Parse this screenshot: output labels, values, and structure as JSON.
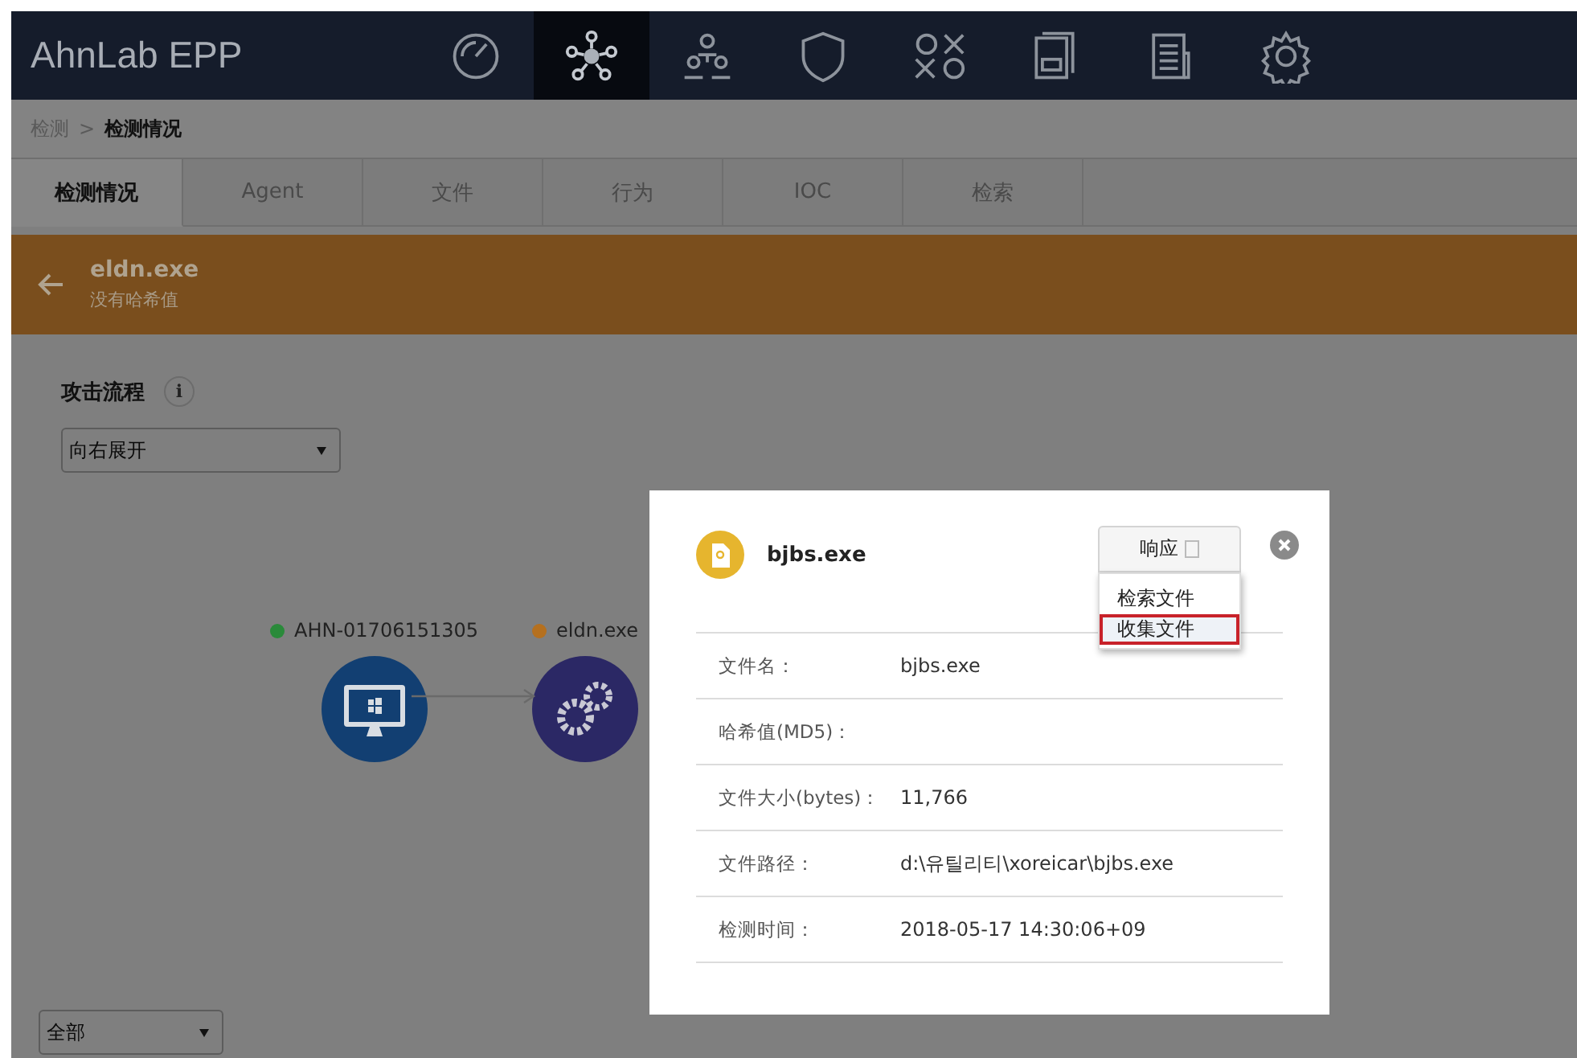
{
  "app": {
    "logo": "AhnLab EPP"
  },
  "nav_icons": [
    {
      "kind": "gauge",
      "selected": false
    },
    {
      "kind": "network",
      "selected": true
    },
    {
      "kind": "people",
      "selected": false
    },
    {
      "kind": "shield",
      "selected": false
    },
    {
      "kind": "oxox",
      "selected": false
    },
    {
      "kind": "report",
      "selected": false
    },
    {
      "kind": "document",
      "selected": false
    },
    {
      "kind": "gear",
      "selected": false
    }
  ],
  "breadcrumb": {
    "separator": ">",
    "items": [
      {
        "label": "检测",
        "current": false
      },
      {
        "label": "检测情况",
        "current": true
      }
    ]
  },
  "tabs": [
    {
      "label": "检测情况",
      "selected": true
    },
    {
      "label": "Agent",
      "selected": false
    },
    {
      "label": "文件",
      "selected": false
    },
    {
      "label": "行为",
      "selected": false
    },
    {
      "label": "IOC",
      "selected": false
    },
    {
      "label": "检索",
      "selected": false
    }
  ],
  "banner": {
    "title": "eldn.exe",
    "subtitle": "没有哈希值"
  },
  "section": {
    "title": "攻击流程",
    "info": "i"
  },
  "layout_select": {
    "value": "向右展开"
  },
  "nodes": [
    {
      "label": "AHN-01706151305",
      "color": "#2a8a3a",
      "kind": "computer"
    },
    {
      "label": "eldn.exe",
      "color": "#b5701f",
      "kind": "process"
    }
  ],
  "filter_select": {
    "value": "全部"
  },
  "dialog": {
    "title": "bjbs.exe",
    "response_button": "响应",
    "menu": [
      {
        "label": "检索文件",
        "selected": false
      },
      {
        "label": "收集文件",
        "selected": true
      }
    ],
    "fields": [
      {
        "label": "文件名：",
        "value": "bjbs.exe"
      },
      {
        "label": "哈希值(MD5)："
      },
      {
        "label": "文件大小(bytes)：",
        "value": "11,766"
      },
      {
        "label": "文件路径：",
        "value": "d:\\유틸리티\\xoreicar\\bjbs.exe"
      },
      {
        "label": "检测时间：",
        "value": "2018-05-17 14:30:06+09"
      }
    ]
  }
}
